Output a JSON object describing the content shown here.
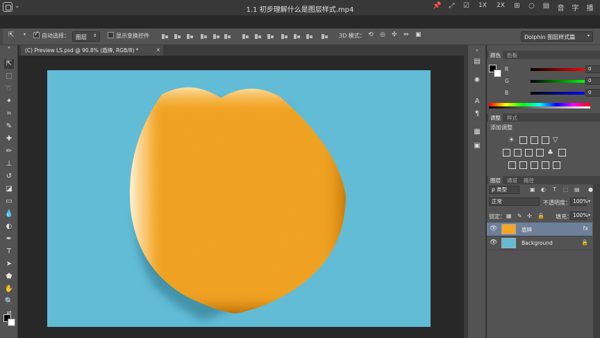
{
  "player": {
    "title": "1.1 初步理解什么是图层样式.mp4",
    "dropdown": "⌄",
    "controls": [
      "📌",
      "⤢",
      "☑",
      "1X",
      "2X",
      "⊞",
      "○",
      "▤",
      "音",
      "字",
      "播"
    ]
  },
  "options_bar": {
    "auto_select_label": "自动选择：",
    "auto_select_value": "图层",
    "show_transform_label": "显示变换控件",
    "mode_3d_label": "3D 模式：",
    "workspace": "Dolphin 图层样式篇"
  },
  "document": {
    "tab_title": "(C) Preview LS.psd @ 90.8% (盾牌, RGB/8) *",
    "close": "×"
  },
  "panels": {
    "color": {
      "tabs": [
        "颜色",
        "色板"
      ],
      "channels": [
        {
          "label": "R",
          "value": "0"
        },
        {
          "label": "G",
          "value": "0"
        },
        {
          "label": "B",
          "value": "0"
        }
      ]
    },
    "adjustments": {
      "tabs": [
        "调整",
        "样式"
      ],
      "add_label": "添加调整"
    },
    "layers": {
      "tabs": [
        "图层",
        "通道",
        "路径"
      ],
      "filter_kind": "ρ 类型",
      "blend_mode": "正常",
      "opacity_label": "不透明度：",
      "opacity_value": "100%",
      "lock_label": "锁定：",
      "fill_label": "填充：",
      "fill_value": "100%",
      "items": [
        {
          "name": "盾牌",
          "selected": true,
          "thumb_color": "#f5a623",
          "icon": "fx"
        },
        {
          "name": "Background",
          "selected": false,
          "thumb_color": "#62bcd6",
          "icon": "🔒"
        }
      ]
    }
  },
  "colors": {
    "canvas_bg": "#62bcd6",
    "shield": "#f5a623"
  }
}
